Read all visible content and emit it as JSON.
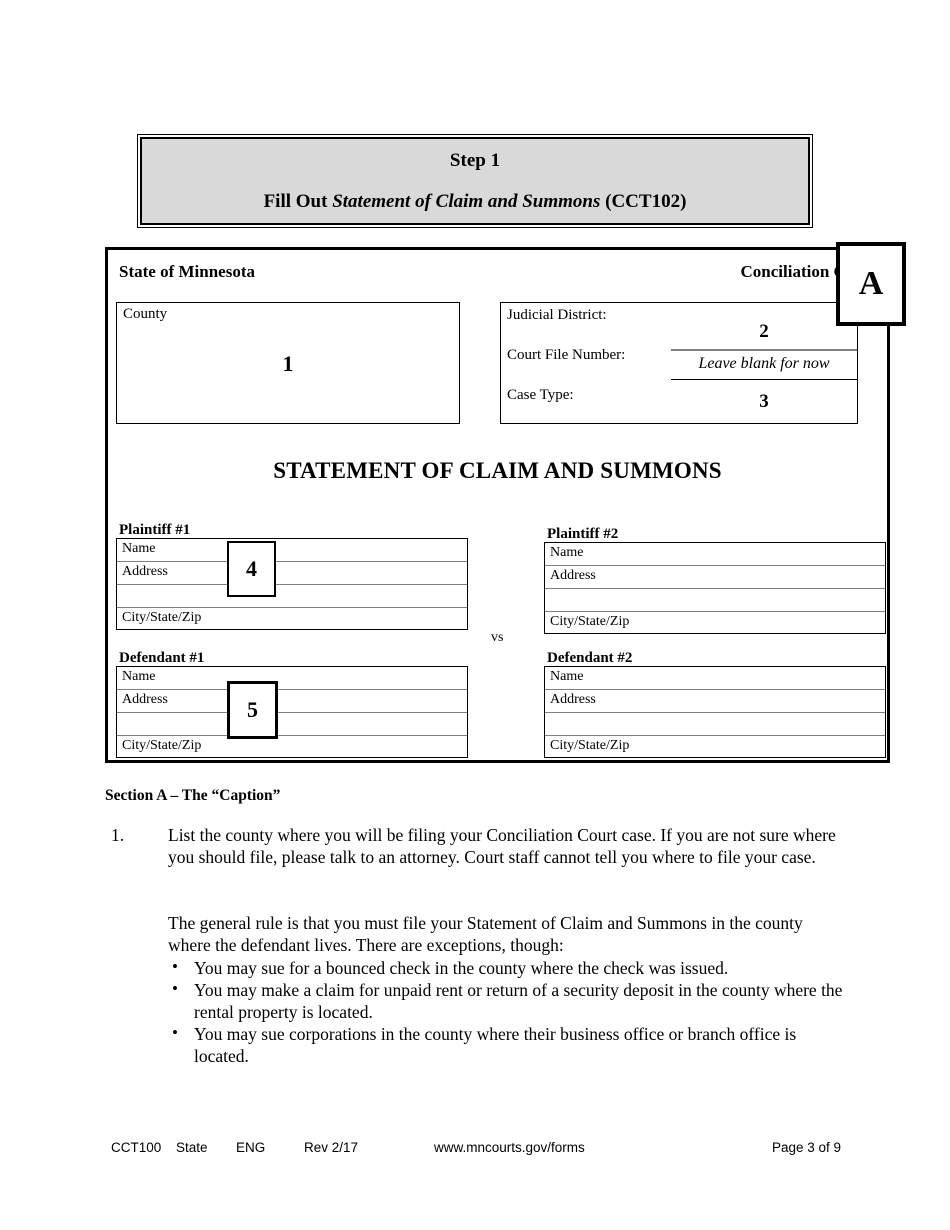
{
  "step_box": {
    "line1": "Step 1",
    "line2_prefix": "Fill Out ",
    "line2_italic": "Statement of Claim and Summons",
    "line2_suffix": " (CCT102)"
  },
  "form": {
    "state_header": "State of Minnesota",
    "court_header": "Conciliation Court",
    "county_label": "County",
    "county_marker": "1",
    "judicial_district_label": "Judicial District:",
    "judicial_district_marker": "2",
    "court_file_number_label": "Court File Number:",
    "court_file_number_value": "Leave blank for now",
    "case_type_label": "Case Type:",
    "case_type_marker": "3",
    "title": "STATEMENT OF CLAIM AND SUMMONS",
    "vs": "vs",
    "row_labels": {
      "name": "Name",
      "address": "Address",
      "blank": "",
      "city_state_zip": "City/State/Zip"
    },
    "parties": [
      {
        "heading": "Plaintiff #1"
      },
      {
        "heading": "Plaintiff #2"
      },
      {
        "heading": "Defendant #1"
      },
      {
        "heading": "Defendant #2"
      }
    ]
  },
  "callouts": {
    "a": "A",
    "four": "4",
    "five": "5"
  },
  "body": {
    "section_heading": "Section A – The “Caption”",
    "item1_marker": "1.",
    "item1_text": "List the county where you will be filing your Conciliation Court case.  If you are not sure where you should file, please talk to an attorney.  Court staff cannot tell you where to file your case.",
    "paragraph": "The general rule is that you must file your Statement of Claim and Summons in the county where the defendant lives.  There are exceptions, though:",
    "bullet_glyph": "•",
    "bullets": [
      "You may sue for a bounced check in the county where the check was issued.",
      "You may make a claim for unpaid rent or return of a security deposit in the county where the rental property is located.",
      "You may sue corporations in the county where their business office or branch office is located."
    ]
  },
  "footer": {
    "form_number": "CCT100",
    "scope": "State",
    "language": "ENG",
    "revision": "Rev 2/17",
    "url": "www.mncourts.gov/forms",
    "page": "Page 3 of 9"
  }
}
